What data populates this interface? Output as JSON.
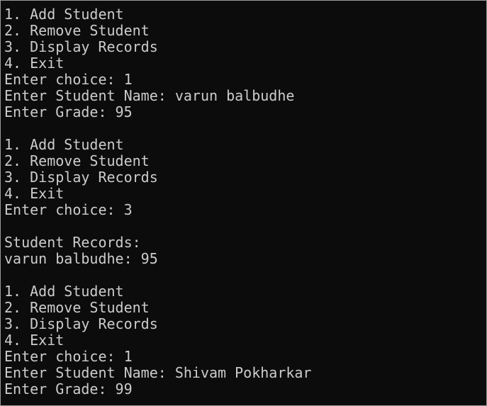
{
  "terminal": {
    "background": "#0c0c0c",
    "foreground": "#cccccc",
    "lines": [
      "1. Add Student",
      "2. Remove Student",
      "3. Display Records",
      "4. Exit",
      "Enter choice: 1",
      "Enter Student Name: varun balbudhe",
      "Enter Grade: 95",
      "",
      "1. Add Student",
      "2. Remove Student",
      "3. Display Records",
      "4. Exit",
      "Enter choice: 3",
      "",
      "Student Records:",
      "varun balbudhe: 95",
      "",
      "1. Add Student",
      "2. Remove Student",
      "3. Display Records",
      "4. Exit",
      "Enter choice: 1",
      "Enter Student Name: Shivam Pokharkar",
      "Enter Grade: 99"
    ]
  }
}
